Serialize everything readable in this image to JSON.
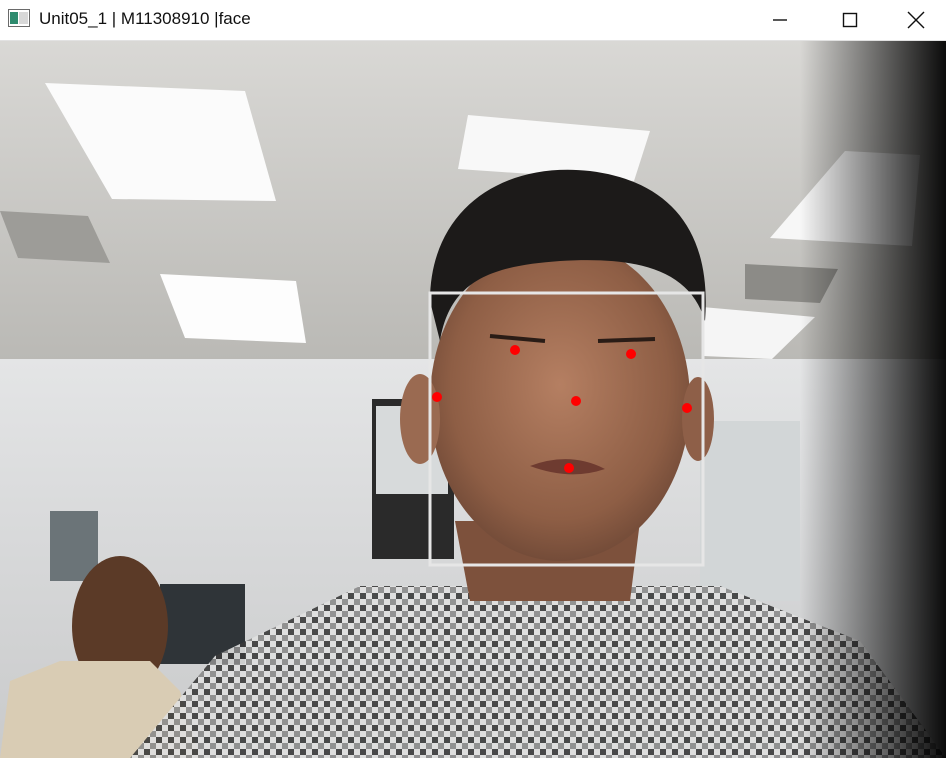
{
  "window": {
    "title": "Unit05_1 | M11308910 |face",
    "app_icon": "opencv-window-icon",
    "controls": [
      {
        "name": "minimize",
        "icon": "minimize-icon"
      },
      {
        "name": "maximize",
        "icon": "maximize-icon"
      },
      {
        "name": "close",
        "icon": "close-icon"
      }
    ]
  },
  "camera_view": {
    "description_visible": false,
    "face_box": {
      "stroke_color": "#e6e6e6"
    },
    "landmarks": {
      "color": "#ff0000",
      "points": [
        "left-eye",
        "right-eye",
        "nose",
        "mouth",
        "left-ear",
        "right-ear"
      ]
    }
  }
}
